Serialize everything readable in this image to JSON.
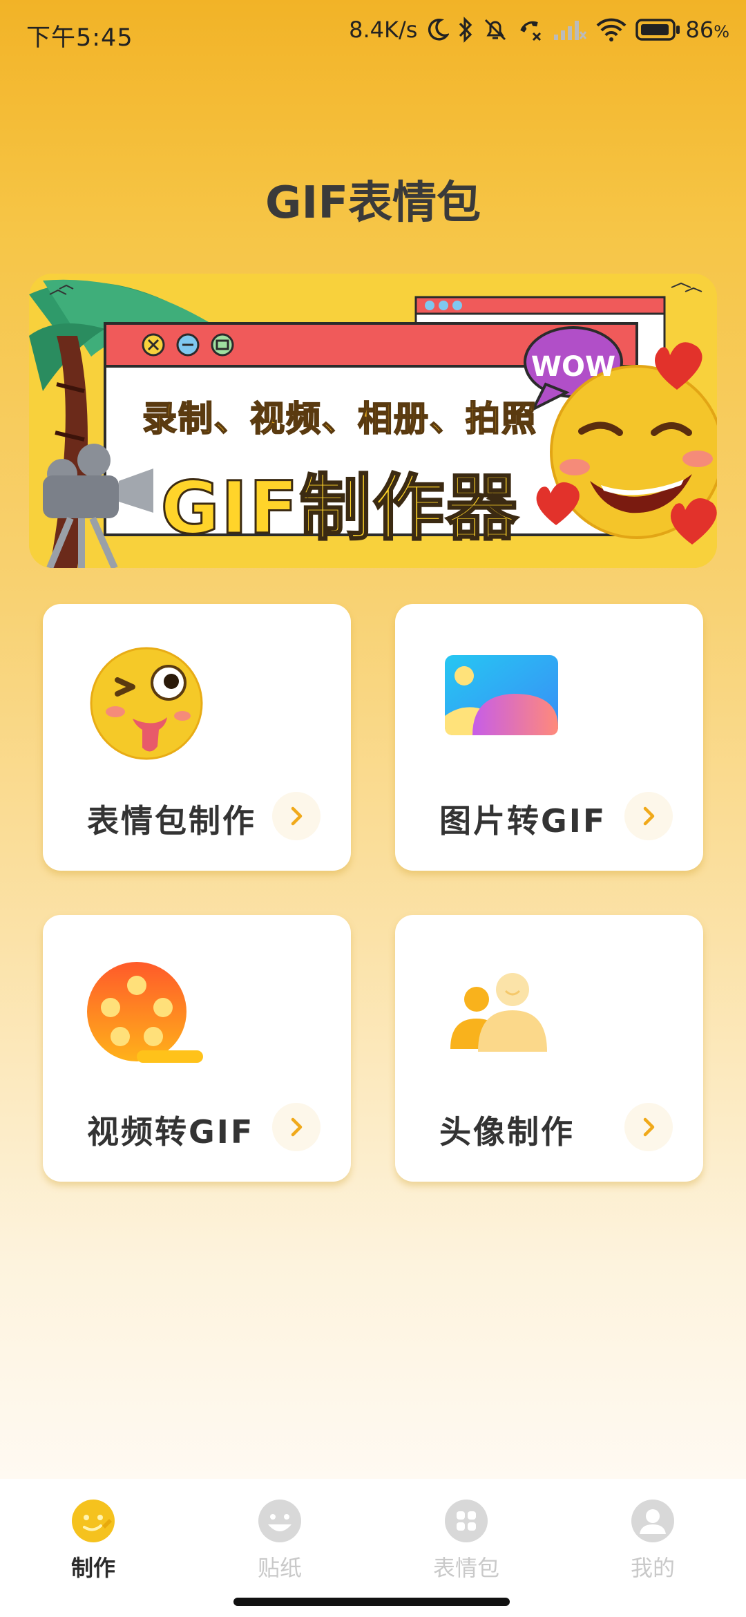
{
  "status_bar": {
    "time": "下午5:45",
    "network_speed": "8.4K/s",
    "battery_percent": "86",
    "battery_unit": "%",
    "icons": [
      "moon-icon",
      "bluetooth-icon",
      "mute-bell-icon",
      "call-blocked-icon",
      "signal-icon",
      "wifi-icon",
      "battery-icon"
    ]
  },
  "page": {
    "title": "GIF表情包"
  },
  "banner": {
    "subtitle": "录制、视频、相册、拍照",
    "title": "GIF制作器",
    "bubble": "WOW"
  },
  "cards": [
    {
      "label": "表情包制作",
      "icon": "winking-emoji-icon"
    },
    {
      "label": "图片转GIF",
      "icon": "image-icon"
    },
    {
      "label": "视频转GIF",
      "icon": "film-reel-icon"
    },
    {
      "label": "头像制作",
      "icon": "avatar-people-icon"
    }
  ],
  "tab_bar": {
    "active_index": 0,
    "tabs": [
      {
        "label": "制作",
        "icon": "make-emoji-icon"
      },
      {
        "label": "贴纸",
        "icon": "sticker-smile-icon"
      },
      {
        "label": "表情包",
        "icon": "grid-icon"
      },
      {
        "label": "我的",
        "icon": "profile-icon"
      }
    ]
  },
  "colors": {
    "accent": "#f5b82a",
    "arrow": "#f0a91a",
    "text": "#333333",
    "inactive": "#c9c9c9"
  }
}
